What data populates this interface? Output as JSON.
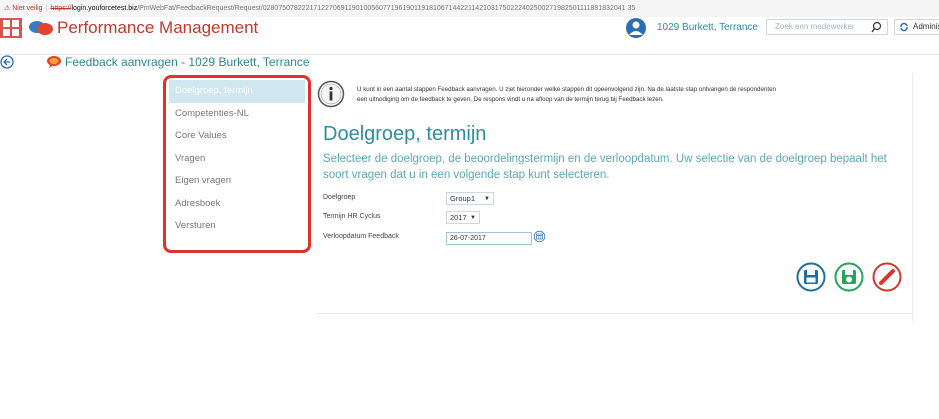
{
  "browser": {
    "security_warning": "Niet veilig",
    "url_protocol": "https://",
    "url_host": "login.youforcetest.biz",
    "url_path": "/PmWebFat/FeedbackRequest/Request/0280750782221712270691190100560771961901191810671442211421031750222402500271982501111881832041 35"
  },
  "app": {
    "title": "Performance Management",
    "user_name": "1029 Burkett, Terrance",
    "search_placeholder": "Zoek een medewerker",
    "admin_label": "Administ",
    "accent_color": "#c0392b",
    "teal_color": "#2b8fa0"
  },
  "page": {
    "title": "Feedback aanvragen - 1029 Burkett, Terrance"
  },
  "nav": {
    "items": [
      {
        "label": "Doelgroep, termijn",
        "active": true
      },
      {
        "label": "Competenties-NL",
        "active": false
      },
      {
        "label": "Core Values",
        "active": false
      },
      {
        "label": "Vragen",
        "active": false
      },
      {
        "label": "Eigen vragen",
        "active": false
      },
      {
        "label": "Adresboek",
        "active": false
      },
      {
        "label": "Versturen",
        "active": false
      }
    ]
  },
  "main": {
    "info_text": "U kunt in een aantal stappen Feedback aanvragen. U ziet hieronder welke stappen dit opeenvolgend zijn. Na de laatste stap ontvangen de respondenten een uitnodiging om de feedback te geven. De respons vindt u na afloop van de termijn terug bij Feedback lezen.",
    "heading": "Doelgroep, termijn",
    "lead": "Selecteer de doelgroep, de beoordelingstermijn en de verloopdatum. Uw selectie van de doelgroep bepaalt het soort vragen dat u in een volgende stap kunt selecteren.",
    "form": {
      "doelgroep_label": "Doelgroep",
      "doelgroep_value": "Group1",
      "termijn_label": "Termijn HR Cyclus",
      "termijn_value": "2017",
      "verloop_label": "Verloopdatum Feedback",
      "verloop_value": "26-07-2017"
    },
    "actions": {
      "save_icon": "save-icon",
      "save_next_icon": "save-next-icon",
      "cancel_icon": "cancel-icon"
    }
  }
}
